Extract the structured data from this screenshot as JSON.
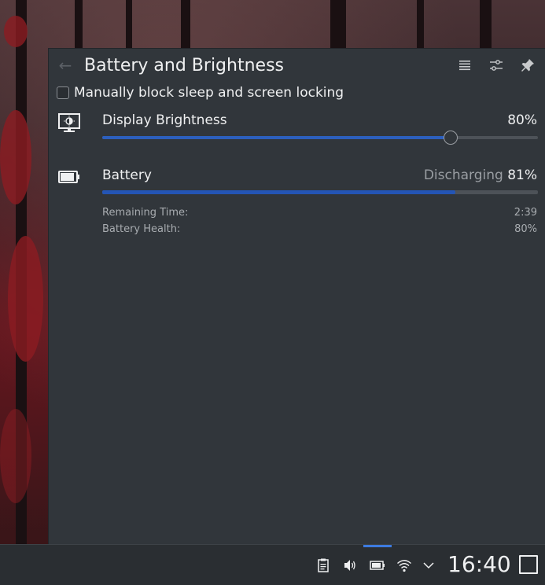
{
  "window": {
    "title": "Battery and Brightness",
    "icons": {
      "back": "back-arrow-icon",
      "menu": "hamburger-menu-icon",
      "configure": "configure-icon",
      "pin": "pin-icon"
    }
  },
  "inhibit": {
    "label": "Manually block sleep and screen locking",
    "checked": false
  },
  "brightness": {
    "label": "Display Brightness",
    "value_text": "80%",
    "value": 0.8,
    "icon": "monitor-brightness-icon"
  },
  "battery": {
    "label": "Battery",
    "status": "Discharging",
    "percent_text": "81%",
    "value": 0.81,
    "icon": "battery-icon",
    "details": [
      {
        "label": "Remaining Time:",
        "value": "2:39"
      },
      {
        "label": "Battery Health:",
        "value": "80%"
      }
    ]
  },
  "panel": {
    "clock": "16:40",
    "tray_icons": [
      "clipboard-icon",
      "volume-icon",
      "battery-icon",
      "wifi-icon",
      "chevron-up-icon"
    ],
    "show_desktop": "show-desktop-icon"
  },
  "colors": {
    "accent": "#2c5fbd",
    "popup_bg": "#31363b",
    "panel_bg": "#2a2e32"
  }
}
